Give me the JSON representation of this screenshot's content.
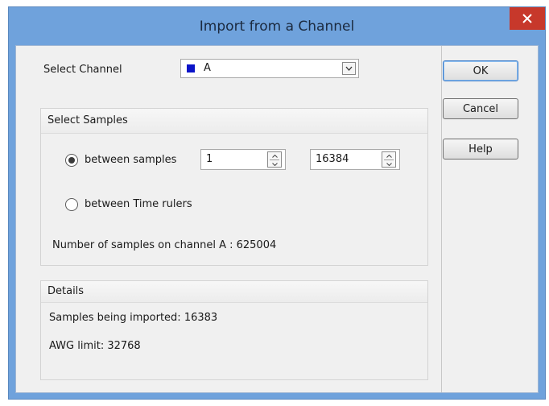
{
  "window": {
    "title": "Import from a Channel",
    "close_glyph": "×"
  },
  "select_channel": {
    "label": "Select Channel",
    "value": "A",
    "swatch_color": "#0b14c8"
  },
  "select_samples": {
    "heading": "Select Samples",
    "option_between_samples": "between samples",
    "option_between_rulers": "between Time rulers",
    "selected_option": "between samples",
    "start_value": "1",
    "end_value": "16384",
    "count_text": "Number of samples on channel A : 625004"
  },
  "details": {
    "heading": "Details",
    "imported_text": "Samples being imported: 16383",
    "awg_limit_text": "AWG limit: 32768"
  },
  "buttons": {
    "ok": "OK",
    "cancel": "Cancel",
    "help": "Help"
  }
}
